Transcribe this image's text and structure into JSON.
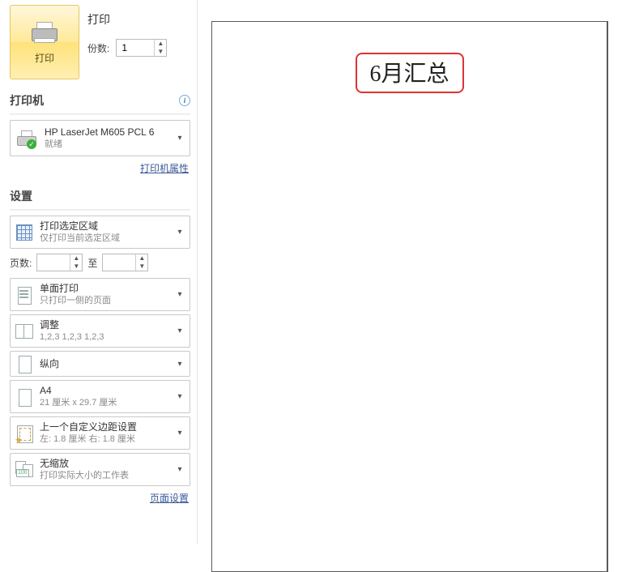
{
  "colors": {
    "accent_border": "#d33"
  },
  "print": {
    "label": "打印",
    "button_label": "打印",
    "copies_label": "份数:",
    "copies_value": "1"
  },
  "printer_section": {
    "heading": "打印机",
    "name": "HP LaserJet M605 PCL 6",
    "status": "就绪",
    "properties_link": "打印机属性"
  },
  "settings": {
    "heading": "设置",
    "print_area": {
      "title": "打印选定区域",
      "sub": "仅打印当前选定区域"
    },
    "pages": {
      "label": "页数:",
      "to": "至",
      "from_value": "",
      "to_value": ""
    },
    "duplex": {
      "title": "单面打印",
      "sub": "只打印一侧的页面"
    },
    "collate": {
      "title": "调整",
      "sub": "1,2,3    1,2,3    1,2,3"
    },
    "orientation": {
      "title": "纵向"
    },
    "paper": {
      "title": "A4",
      "sub": "21 厘米 x 29.7 厘米"
    },
    "margins": {
      "title": "上一个自定义边距设置",
      "sub": "左: 1.8 厘米    右: 1.8 厘米"
    },
    "scaling": {
      "title": "无缩放",
      "sub": "打印实际大小的工作表"
    },
    "page_setup_link": "页面设置"
  },
  "preview": {
    "title": "6月汇总"
  }
}
